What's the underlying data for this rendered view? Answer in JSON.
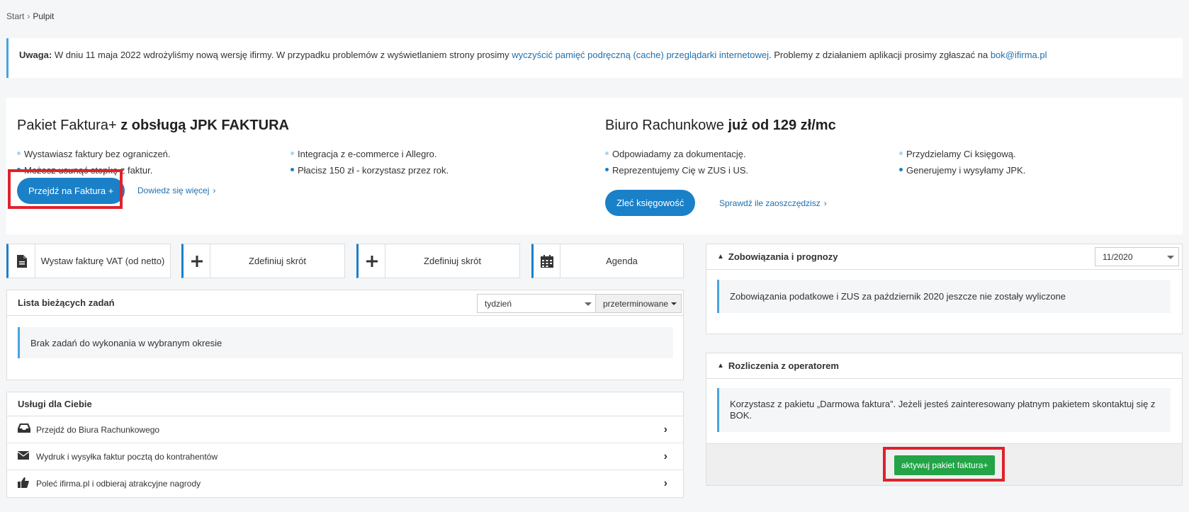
{
  "breadcrumb": {
    "start": "Start",
    "separator": "›",
    "current": "Pulpit"
  },
  "notice": {
    "label": "Uwaga:",
    "text_before": " W dniu 11 maja 2022 wdrożyliśmy nową wersję ifirmy. W przypadku problemów z wyświetlaniem strony prosimy ",
    "link1": "wyczyścić pamięć podręczną (cache) przeglądarki internetowej",
    "text_middle": ". Problemy z działaniem aplikacji prosimy zgłaszać na ",
    "link2": "bok@ifirma.pl"
  },
  "promo_left": {
    "title_normal": "Pakiet Faktura+ ",
    "title_bold": "z obsługą JPK FAKTURA",
    "bullets_col1": [
      "Wystawiasz faktury bez ograniczeń.",
      "Możesz usunąć stopkę z faktur."
    ],
    "bullets_col2": [
      "Integracja z e-commerce i Allegro.",
      "Płacisz 150 zł - korzystasz przez rok."
    ],
    "button": "Przejdź na Faktura +",
    "link": "Dowiedz się więcej"
  },
  "promo_right": {
    "title_normal": "Biuro Rachunkowe ",
    "title_bold": "już od 129 zł/mc",
    "bullets_col1": [
      "Odpowiadamy za dokumentację.",
      "Reprezentujemy Cię w ZUS i US."
    ],
    "bullets_col2": [
      "Przydzielamy Ci księgową.",
      "Generujemy i wysyłamy JPK."
    ],
    "button": "Zleć księgowość",
    "link": "Sprawdź ile zaoszczędzisz"
  },
  "shortcuts": [
    {
      "icon": "document-icon",
      "label": "Wystaw fakturę VAT (od netto)"
    },
    {
      "icon": "plus-icon",
      "label": "Zdefiniuj skrót"
    },
    {
      "icon": "plus-icon",
      "label": "Zdefiniuj skrót"
    },
    {
      "icon": "calendar-icon",
      "label": "Agenda"
    }
  ],
  "tasks": {
    "title": "Lista bieżących zadań",
    "period_select": "tydzień",
    "filter_button": "przeterminowane",
    "empty_message": "Brak zadań do wykonania w wybranym okresie"
  },
  "services": {
    "title": "Usługi dla Ciebie",
    "items": [
      {
        "icon": "inbox-icon",
        "label": "Przejdź do Biura Rachunkowego"
      },
      {
        "icon": "envelope-icon",
        "label": "Wydruk i wysyłka faktur pocztą do kontrahentów"
      },
      {
        "icon": "thumbs-up-icon",
        "label": "Poleć ifirma.pl i odbieraj atrakcyjne nagrody"
      }
    ]
  },
  "obligations": {
    "title": "Zobowiązania i prognozy",
    "month_select": "11/2020",
    "message": "Zobowiązania podatkowe i ZUS za październik 2020 jeszcze nie zostały wyliczone"
  },
  "settlements": {
    "title": "Rozliczenia z operatorem",
    "message": "Korzystasz z pakietu „Darmowa faktura”. Jeżeli jesteś zainteresowany płatnym pakietem skontaktuj się z BOK.",
    "button": "aktywuj pakiet faktura+"
  },
  "colors": {
    "accent": "#1a80c8",
    "highlight": "#e0212b",
    "success": "#22a447"
  }
}
